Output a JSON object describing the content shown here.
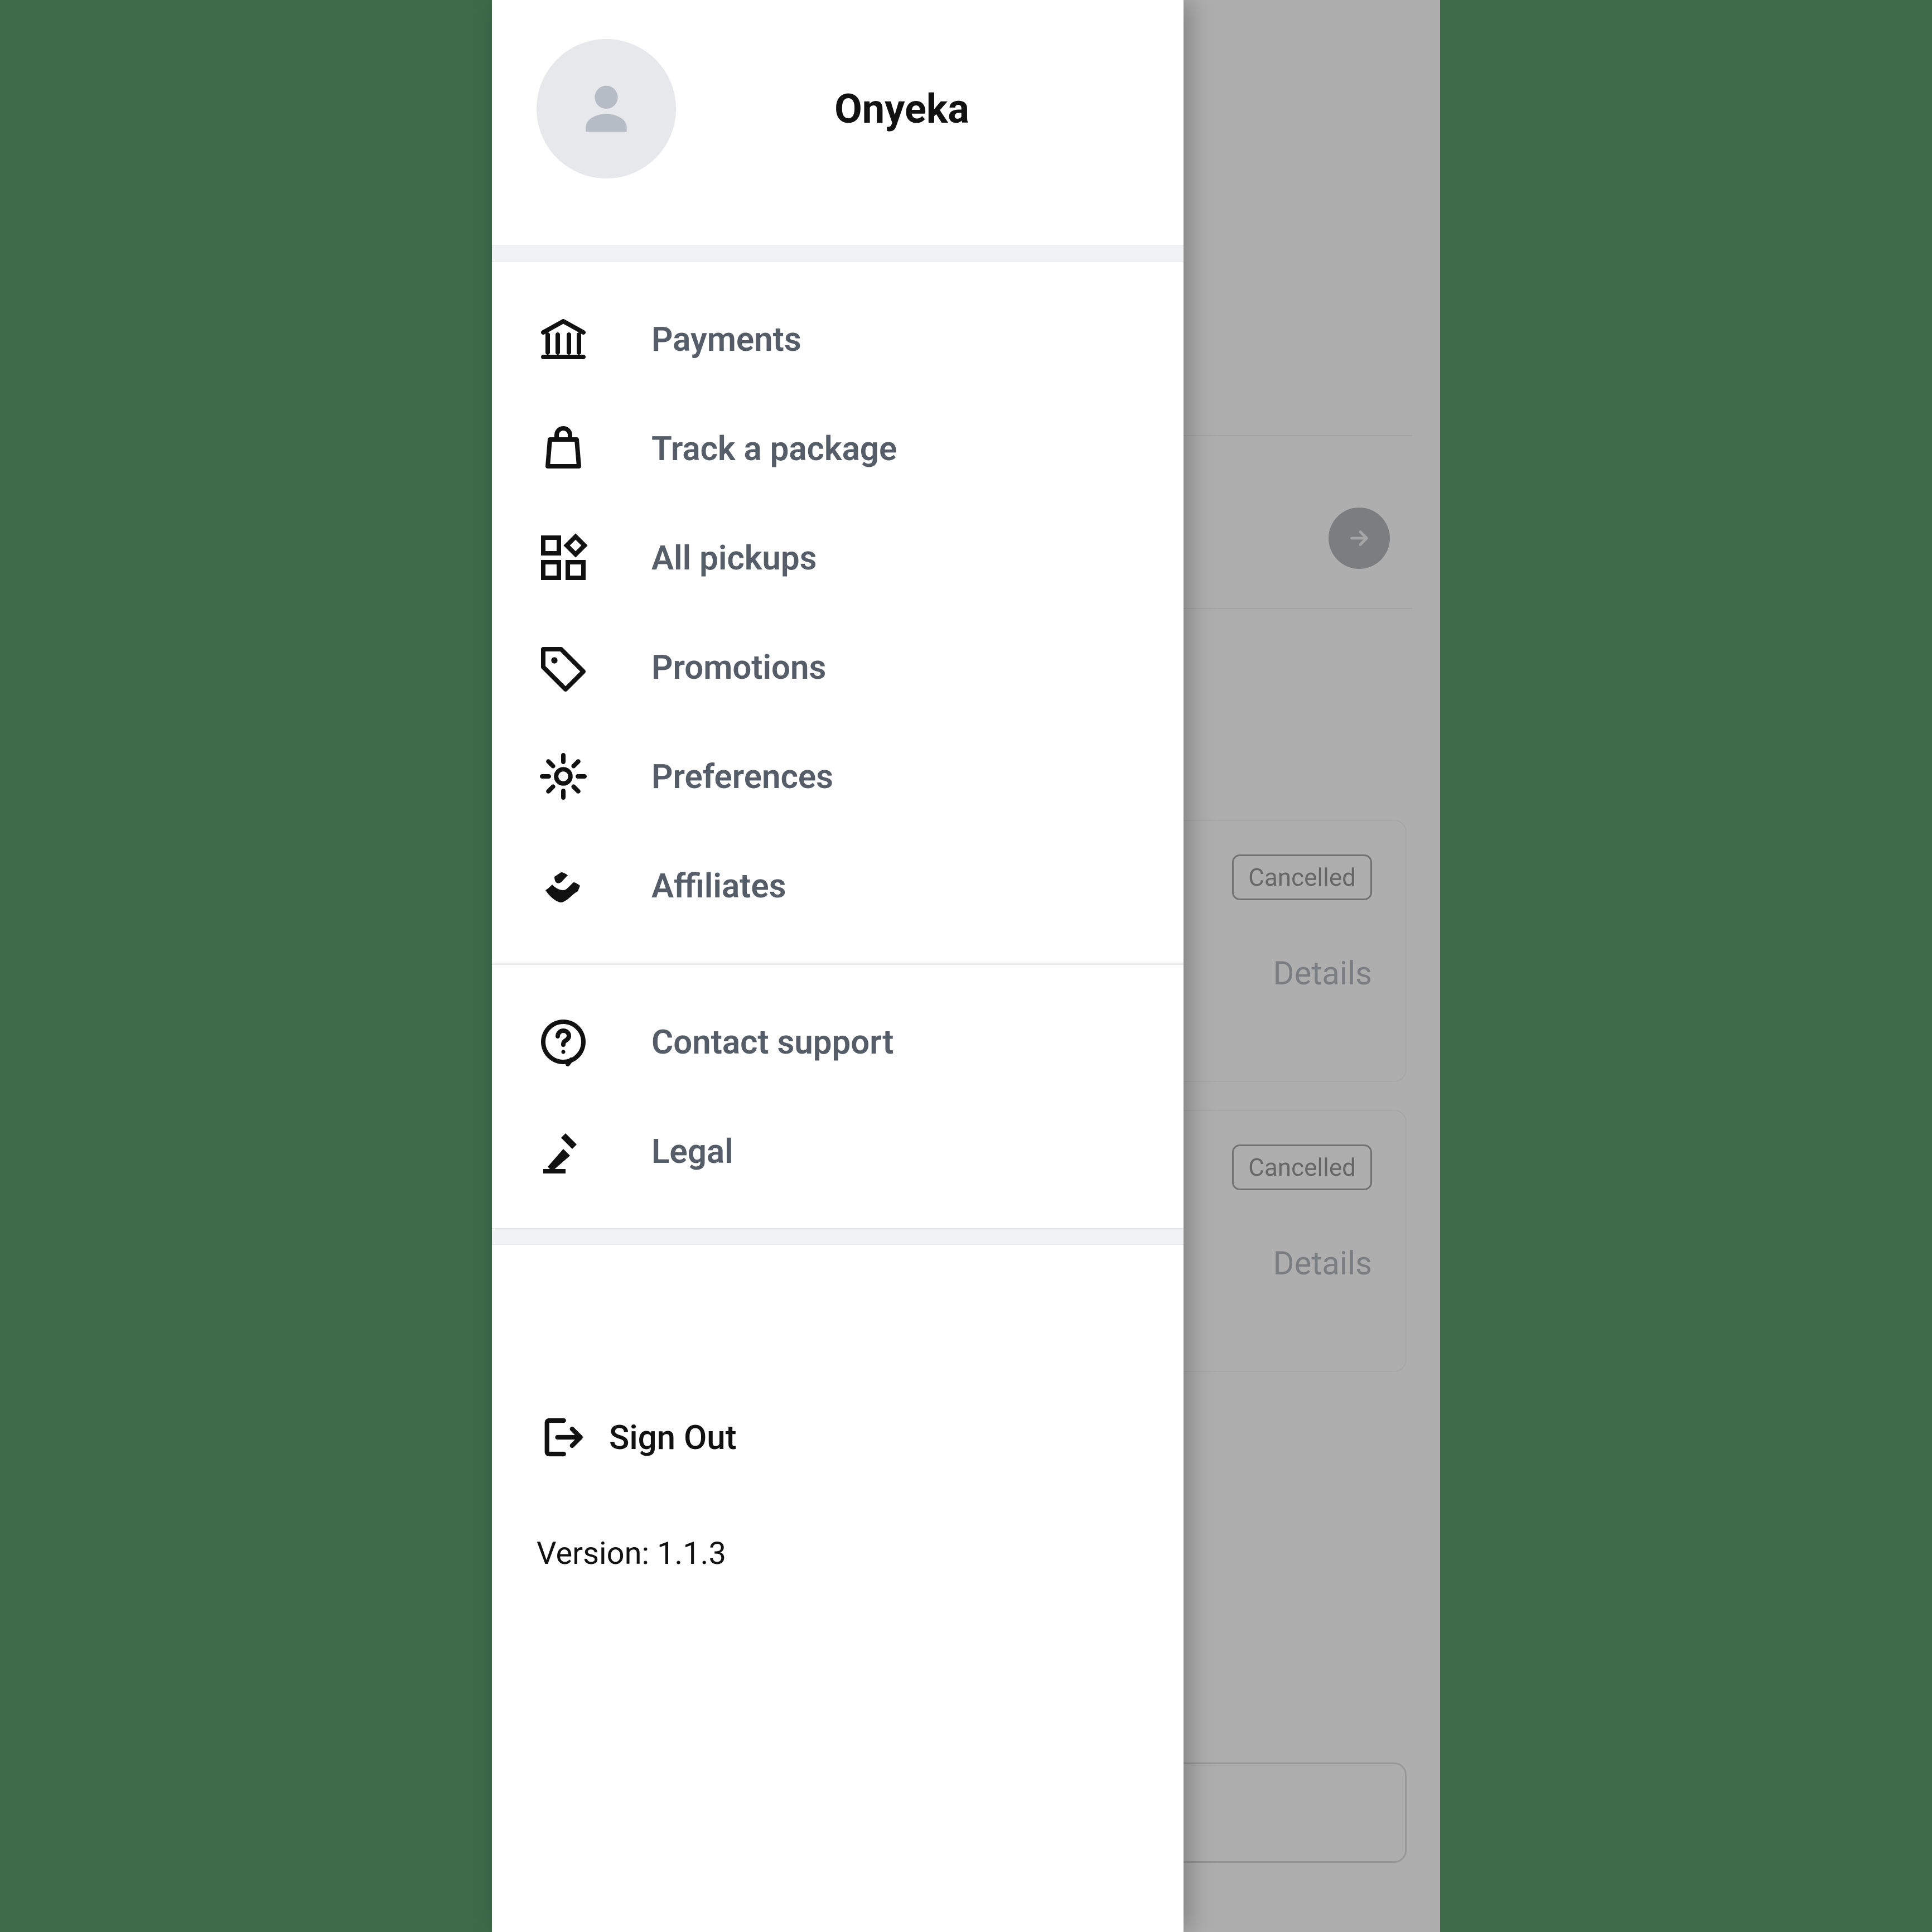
{
  "profile": {
    "name": "Onyeka"
  },
  "menu": {
    "group1": [
      {
        "icon": "bank-icon",
        "label": "Payments"
      },
      {
        "icon": "bag-icon",
        "label": "Track a package"
      },
      {
        "icon": "widgets-icon",
        "label": "All pickups"
      },
      {
        "icon": "tag-icon",
        "label": "Promotions"
      },
      {
        "icon": "gear-icon",
        "label": "Preferences"
      },
      {
        "icon": "handshake-icon",
        "label": "Affiliates"
      }
    ],
    "group2": [
      {
        "icon": "help-icon",
        "label": "Contact support"
      },
      {
        "icon": "gavel-icon",
        "label": "Legal"
      }
    ]
  },
  "signout_label": "Sign Out",
  "version_label": "Version: 1.1.3",
  "background": {
    "cards": [
      {
        "status": "Cancelled",
        "details": "Details"
      },
      {
        "status": "Cancelled",
        "details": "Details"
      }
    ]
  }
}
